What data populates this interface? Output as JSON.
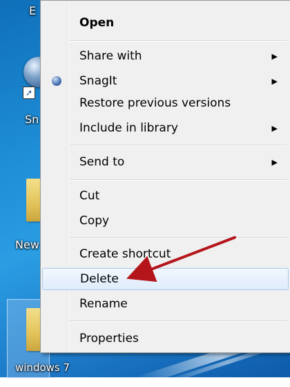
{
  "desktop": {
    "icons": {
      "top_label": "E",
      "snagit_label": "Sn",
      "new_folder_label": "New",
      "selected_folder_label": "windows 7"
    }
  },
  "context_menu": {
    "items": {
      "open": "Open",
      "share_with": "Share with",
      "snagit": "SnagIt",
      "restore_previous_versions": "Restore previous versions",
      "include_in_library": "Include in library",
      "send_to": "Send to",
      "cut": "Cut",
      "copy": "Copy",
      "create_shortcut": "Create shortcut",
      "delete": "Delete",
      "rename": "Rename",
      "properties": "Properties"
    },
    "submenu_glyph": "▶",
    "highlighted_item": "delete"
  },
  "annotation": {
    "arrow_color": "#b4151b",
    "points_to": "delete"
  },
  "colors": {
    "menu_background": "#f0f0f0",
    "highlight_border": "#a8c8ec",
    "desktop_blue": "#1f8fd8"
  }
}
